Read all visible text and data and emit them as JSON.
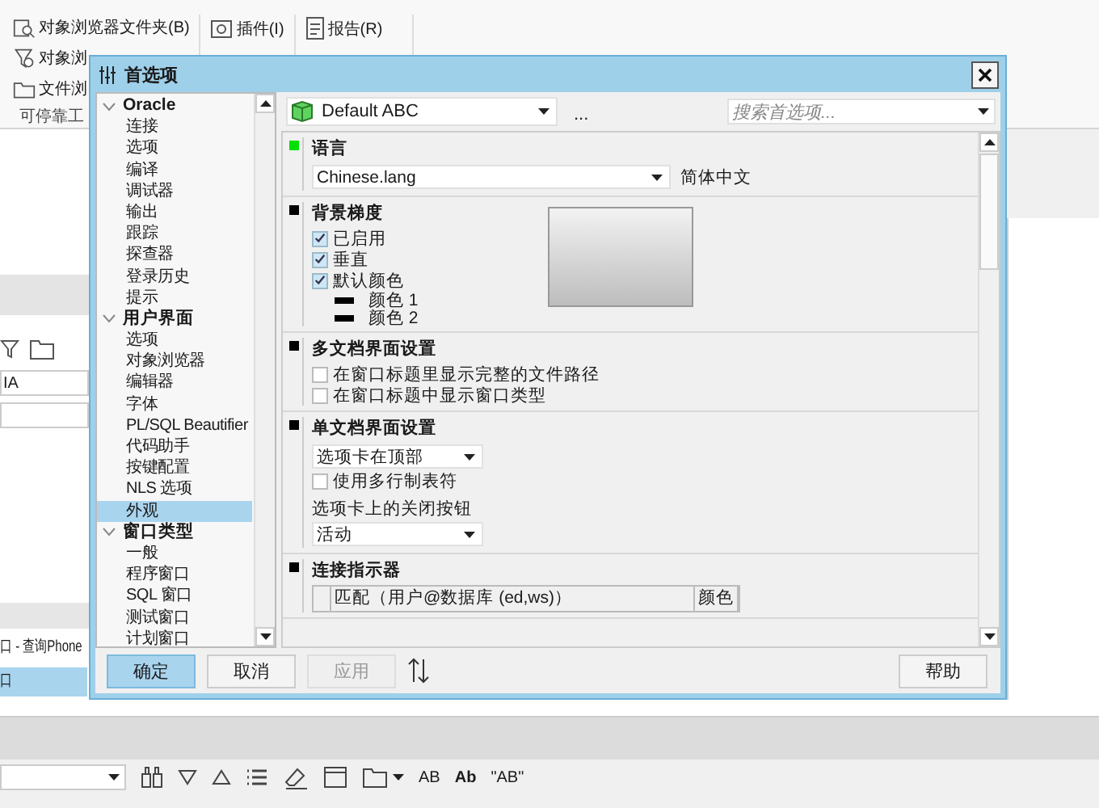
{
  "background_app": {
    "ribbon": {
      "group_1": [
        "对象浏览器文件夹(B)",
        "对象浏",
        "文件浏"
      ],
      "group_1_label": "可停靠工",
      "group_2": [
        "插件(I)"
      ],
      "group_3": [
        "报告(R)"
      ]
    },
    "left_panel": {
      "field": "IA",
      "list": [
        {
          "label": "口 - 查询Phone",
          "selected": false
        },
        {
          "label": "口",
          "selected": true
        }
      ]
    },
    "toolbar": {
      "text_buttons": [
        "AB",
        "Ab",
        "\"AB\""
      ]
    }
  },
  "dialog": {
    "title": "首选项",
    "tree": [
      {
        "label": "Oracle",
        "expanded": true,
        "children": [
          {
            "label": "连接",
            "selected": false
          },
          {
            "label": "选项",
            "selected": false
          },
          {
            "label": "编译",
            "selected": false
          },
          {
            "label": "调试器",
            "selected": false
          },
          {
            "label": "输出",
            "selected": false
          },
          {
            "label": "跟踪",
            "selected": false
          },
          {
            "label": "探查器",
            "selected": false
          },
          {
            "label": "登录历史",
            "selected": false
          },
          {
            "label": "提示",
            "selected": false
          }
        ]
      },
      {
        "label": "用户界面",
        "expanded": true,
        "children": [
          {
            "label": "选项",
            "selected": false
          },
          {
            "label": "对象浏览器",
            "selected": false
          },
          {
            "label": "编辑器",
            "selected": false
          },
          {
            "label": "字体",
            "selected": false
          },
          {
            "label": "PL/SQL Beautifier",
            "selected": false
          },
          {
            "label": "代码助手",
            "selected": false
          },
          {
            "label": "按键配置",
            "selected": false
          },
          {
            "label": "NLS 选项",
            "selected": false
          },
          {
            "label": "外观",
            "selected": true
          }
        ]
      },
      {
        "label": "窗口类型",
        "expanded": true,
        "children": [
          {
            "label": "一般",
            "selected": false
          },
          {
            "label": "程序窗口",
            "selected": false
          },
          {
            "label": "SQL 窗口",
            "selected": false
          },
          {
            "label": "测试窗口",
            "selected": false
          },
          {
            "label": "计划窗口",
            "selected": false
          }
        ]
      }
    ],
    "profile": "Default ABC",
    "more": "...",
    "search": {
      "placeholder": "搜索首选项..."
    },
    "sections": [
      {
        "title": "语言",
        "color": "#00e000",
        "items": [
          {
            "kind": "dropdown",
            "value": "Chinese.lang",
            "note": "简体中文"
          }
        ]
      },
      {
        "title": "背景梯度",
        "color": "#000000",
        "preview": {
          "kind": "gradient"
        },
        "items": [
          {
            "kind": "checkbox",
            "label": "已启用",
            "checked": true
          },
          {
            "kind": "checkbox",
            "label": "垂直",
            "checked": true
          },
          {
            "kind": "checkbox",
            "label": "默认颜色",
            "checked": true
          },
          {
            "kind": "swatch",
            "label": "颜色 1",
            "color": "#000000"
          },
          {
            "kind": "swatch",
            "label": "颜色 2",
            "color": "#000000"
          }
        ]
      },
      {
        "title": "多文档界面设置",
        "color": "#000000",
        "items": [
          {
            "kind": "checkbox",
            "label": "在窗口标题里显示完整的文件路径",
            "checked": false
          },
          {
            "kind": "checkbox",
            "label": "在窗口标题中显示窗口类型",
            "checked": false
          }
        ]
      },
      {
        "title": "单文档界面设置",
        "color": "#000000",
        "items": [
          {
            "kind": "dropdown",
            "value": "选项卡在顶部"
          },
          {
            "kind": "checkbox",
            "label": "使用多行制表符",
            "checked": false
          },
          {
            "kind": "caption",
            "label": "选项卡上的关闭按钮"
          },
          {
            "kind": "dropdown",
            "value": "活动"
          }
        ]
      },
      {
        "title": "连接指示器",
        "color": "#000000",
        "items": [
          {
            "kind": "table",
            "columns": [
              "匹配（用户@数据库 (ed,ws)）",
              "颜色"
            ]
          }
        ]
      }
    ],
    "buttons": [
      {
        "label": "确定",
        "default": true,
        "disabled": false
      },
      {
        "label": "取消",
        "default": false,
        "disabled": false
      },
      {
        "label": "应用",
        "default": false,
        "disabled": true
      }
    ],
    "help_button": "帮助"
  }
}
